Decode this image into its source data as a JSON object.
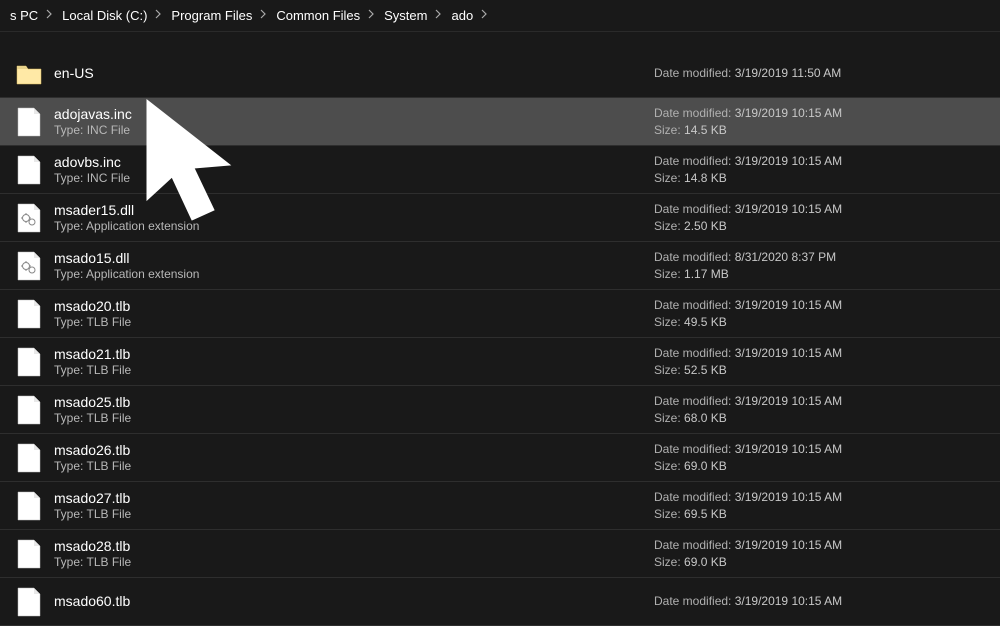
{
  "breadcrumb": {
    "items": [
      "s PC",
      "Local Disk (C:)",
      "Program Files",
      "Common Files",
      "System",
      "ado"
    ]
  },
  "labels": {
    "type_prefix": "Type:",
    "date_prefix": "Date modified:",
    "size_prefix": "Size:"
  },
  "files": [
    {
      "name": "en-US",
      "type": "",
      "date": "3/19/2019 11:50 AM",
      "size": "",
      "icon": "folder",
      "selected": false
    },
    {
      "name": "adojavas.inc",
      "type": "INC File",
      "date": "3/19/2019 10:15 AM",
      "size": "14.5 KB",
      "icon": "file",
      "selected": true
    },
    {
      "name": "adovbs.inc",
      "type": "INC File",
      "date": "3/19/2019 10:15 AM",
      "size": "14.8 KB",
      "icon": "file",
      "selected": false
    },
    {
      "name": "msader15.dll",
      "type": "Application extension",
      "date": "3/19/2019 10:15 AM",
      "size": "2.50 KB",
      "icon": "dll",
      "selected": false
    },
    {
      "name": "msado15.dll",
      "type": "Application extension",
      "date": "8/31/2020 8:37 PM",
      "size": "1.17 MB",
      "icon": "dll",
      "selected": false
    },
    {
      "name": "msado20.tlb",
      "type": "TLB File",
      "date": "3/19/2019 10:15 AM",
      "size": "49.5 KB",
      "icon": "file",
      "selected": false
    },
    {
      "name": "msado21.tlb",
      "type": "TLB File",
      "date": "3/19/2019 10:15 AM",
      "size": "52.5 KB",
      "icon": "file",
      "selected": false
    },
    {
      "name": "msado25.tlb",
      "type": "TLB File",
      "date": "3/19/2019 10:15 AM",
      "size": "68.0 KB",
      "icon": "file",
      "selected": false
    },
    {
      "name": "msado26.tlb",
      "type": "TLB File",
      "date": "3/19/2019 10:15 AM",
      "size": "69.0 KB",
      "icon": "file",
      "selected": false
    },
    {
      "name": "msado27.tlb",
      "type": "TLB File",
      "date": "3/19/2019 10:15 AM",
      "size": "69.5 KB",
      "icon": "file",
      "selected": false
    },
    {
      "name": "msado28.tlb",
      "type": "TLB File",
      "date": "3/19/2019 10:15 AM",
      "size": "69.0 KB",
      "icon": "file",
      "selected": false
    },
    {
      "name": "msado60.tlb",
      "type": "",
      "date": "3/19/2019 10:15 AM",
      "size": "",
      "icon": "file",
      "selected": false
    }
  ]
}
